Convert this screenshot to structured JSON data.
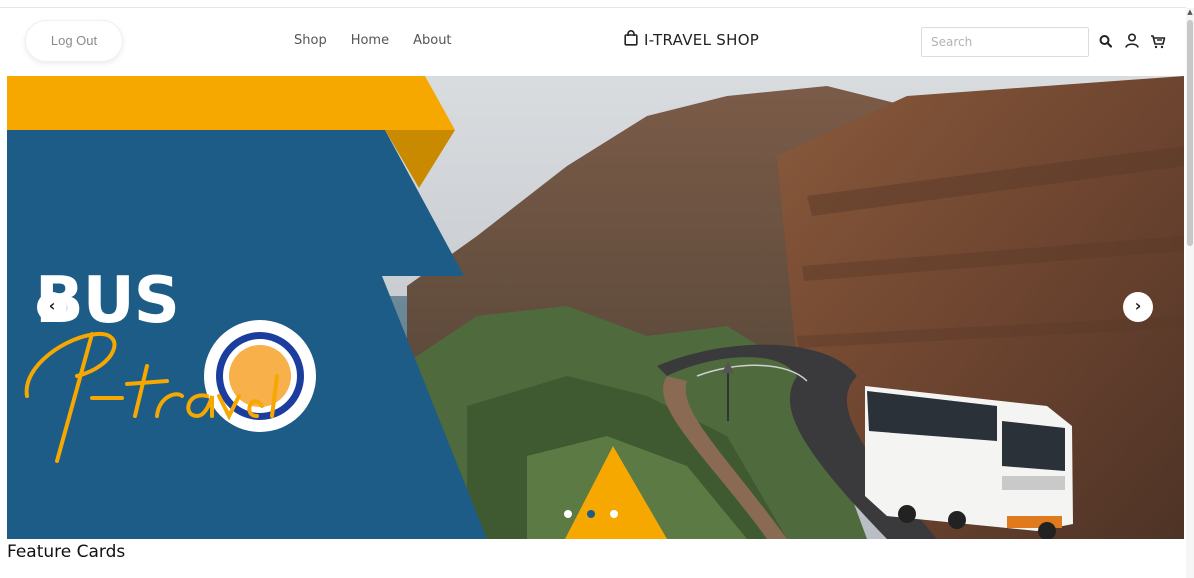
{
  "header": {
    "logout_label": "Log Out",
    "nav": [
      "Shop",
      "Home",
      "About"
    ],
    "brand": "I-TRAVEL SHOP",
    "search_placeholder": "Search",
    "icons": [
      "search-icon",
      "user-icon",
      "cart-icon",
      "shopping-bag-icon"
    ]
  },
  "hero": {
    "headline": "BUS",
    "script_text": "I-travel",
    "slides": 3,
    "active_slide": 2,
    "prev_label": "‹",
    "next_label": "›"
  },
  "section": {
    "title": "Feature Cards"
  },
  "colors": {
    "navy": "#1c5c86",
    "gold": "#f6a800",
    "gold_dark": "#c98a00",
    "badge_blue": "#1a3d9e",
    "badge_orange": "#f7b04a"
  }
}
